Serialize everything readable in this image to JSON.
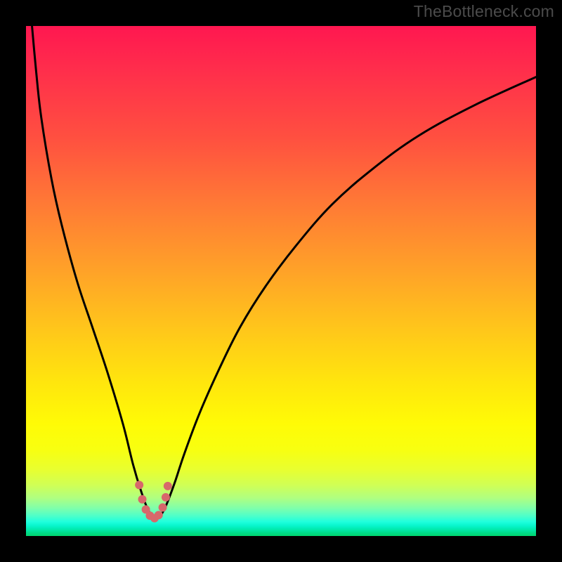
{
  "watermark": "TheBottleneck.com",
  "colors": {
    "background": "#000000",
    "curve_stroke": "#000000",
    "marker_stroke": "#d7686b",
    "gradient_top": "#ff1750",
    "gradient_bottom": "#00d66f"
  },
  "chart_data": {
    "type": "line",
    "title": "",
    "xlabel": "",
    "ylabel": "",
    "xlim": [
      0,
      100
    ],
    "ylim": [
      0,
      100
    ],
    "grid": false,
    "series": [
      {
        "name": "bottleneck-curve",
        "x": [
          1,
          2,
          3,
          5,
          7,
          10,
          13,
          16,
          19,
          21,
          22.5,
          24,
          25.5,
          27,
          29,
          31,
          34,
          38,
          42,
          47,
          53,
          60,
          68,
          77,
          88,
          100
        ],
        "values": [
          102,
          91,
          82,
          70,
          61,
          50,
          41,
          32,
          22,
          14,
          9,
          5,
          3.5,
          5,
          10,
          16,
          24,
          33,
          41,
          49,
          57,
          65,
          72,
          78.5,
          84.5,
          90
        ]
      }
    ],
    "markers": {
      "name": "optimal-range",
      "x": [
        22.2,
        22.8,
        23.5,
        24.3,
        25.2,
        26.0,
        26.8,
        27.4,
        27.8
      ],
      "values": [
        10.0,
        7.2,
        5.2,
        4.0,
        3.5,
        4.1,
        5.6,
        7.6,
        9.8
      ]
    },
    "annotations": []
  }
}
